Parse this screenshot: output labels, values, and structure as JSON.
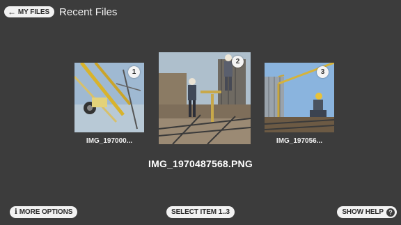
{
  "header": {
    "back_label": "MY FILES",
    "back_icon": "arrow-left-icon",
    "title": "Recent Files"
  },
  "carousel": {
    "items": [
      {
        "index": "1",
        "caption": "IMG_197000...",
        "scene": "crane-detail"
      },
      {
        "index": "2",
        "caption": "",
        "scene": "construction-workers"
      },
      {
        "index": "3",
        "caption": "IMG_197056...",
        "scene": "worker-crane"
      }
    ],
    "selected_index": 2,
    "selected_filename": "IMG_1970487568.PNG"
  },
  "footer": {
    "more_options_label": "MORE OPTIONS",
    "more_options_icon": "info-icon",
    "select_label": "SELECT ITEM 1..3",
    "help_label": "SHOW HELP",
    "help_icon": "help-icon"
  },
  "colors": {
    "background": "#3c3c3c",
    "pill": "#f2f2f2",
    "pill_text": "#2b2b2b"
  }
}
